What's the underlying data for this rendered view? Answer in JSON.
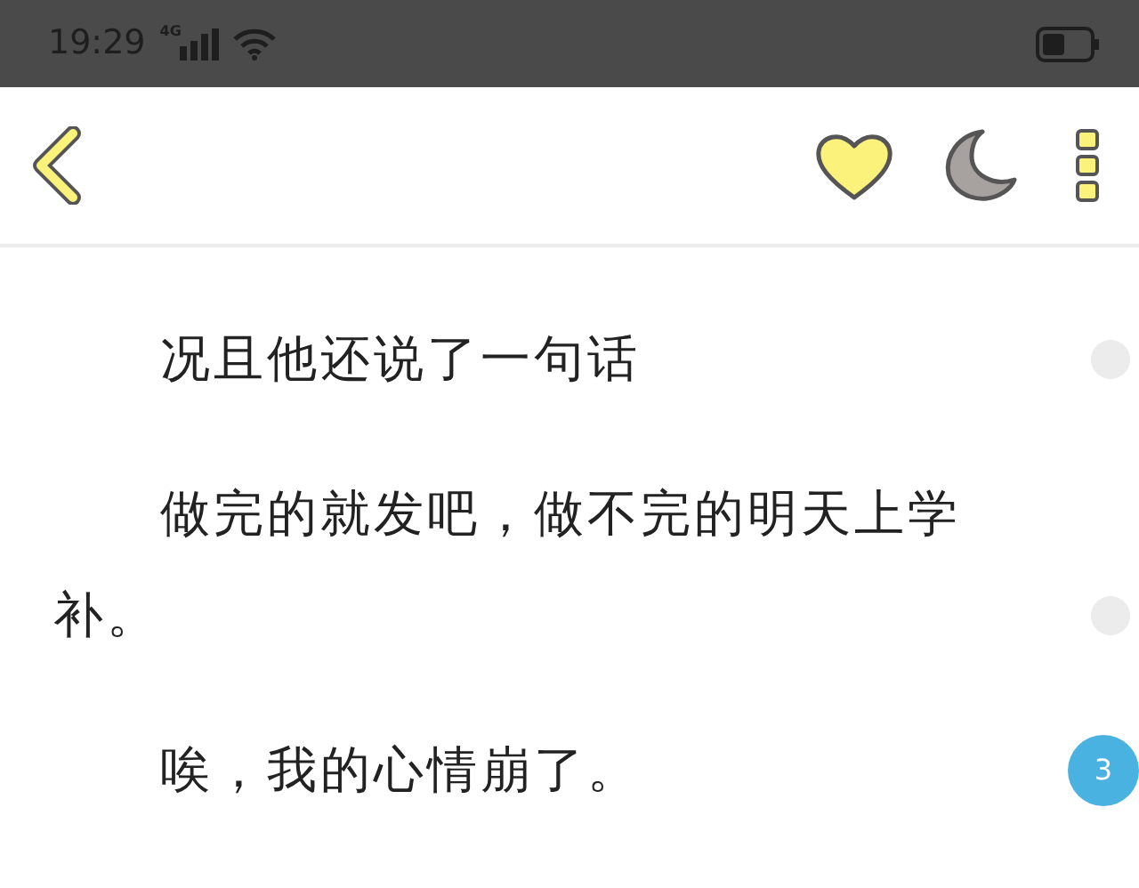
{
  "status_bar": {
    "time": "19:29",
    "network": "4G"
  },
  "paragraphs": [
    {
      "text": "况且他还说了一句话"
    },
    {
      "text": "做完的就发吧，做不完的明天上学补。"
    },
    {
      "text": "唉，我的心情崩了。",
      "comments": "3"
    }
  ]
}
